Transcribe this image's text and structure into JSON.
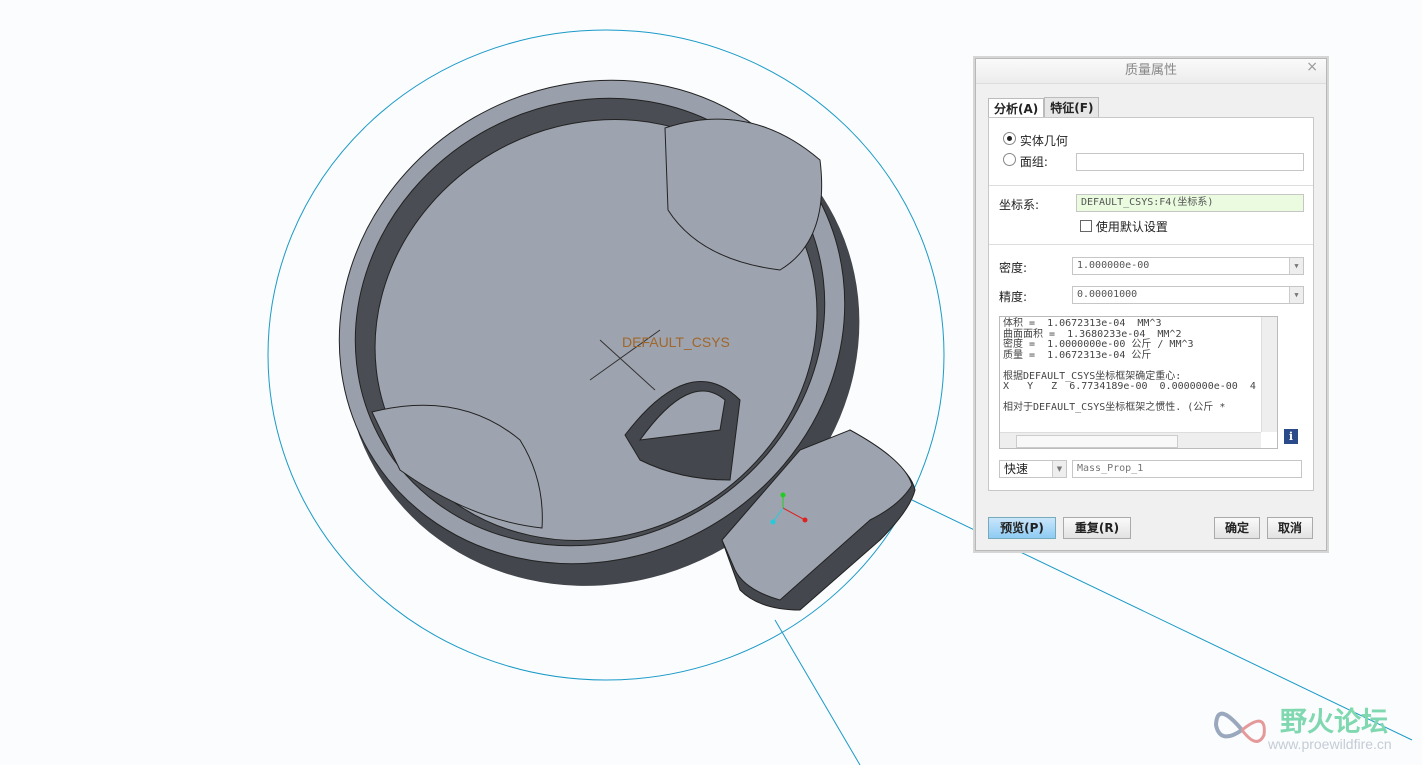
{
  "viewport": {
    "csys_label": "DEFAULT_CSYS"
  },
  "dialog": {
    "title": "质量属性",
    "close_icon": "×",
    "tabs": [
      {
        "label": "分析(A)",
        "active": true
      },
      {
        "label": "特征(F)",
        "active": false
      }
    ],
    "geometry": {
      "solid_label": "实体几何",
      "solid_selected": true,
      "quilt_label": "面组:",
      "quilt_value": ""
    },
    "csys": {
      "label": "坐标系:",
      "value": "DEFAULT_CSYS:F4(坐标系)",
      "use_default_label": "使用默认设置",
      "use_default_checked": false
    },
    "density": {
      "label": "密度:",
      "value": "1.000000e-00"
    },
    "accuracy": {
      "label": "精度:",
      "value": "0.00001000"
    },
    "results": "体积 =  1.0672313e-04  MM^3\n曲面面积 =  1.3680233e-04  MM^2\n密度 =  1.0000000e-00 公斤 / MM^3\n质量 =  1.0672313e-04 公斤\n\n根据DEFAULT_CSYS坐标框架确定重心:\nX   Y   Z  6.7734189e-00  0.0000000e-00  4\n\n相对于DEFAULT_CSYS坐标框架之惯性. (公斤 *",
    "mode": {
      "value": "快速"
    },
    "feature_name": {
      "placeholder": "Mass_Prop_1"
    },
    "buttons": {
      "preview": "预览(P)",
      "repeat": "重复(R)",
      "ok": "确定",
      "cancel": "取消"
    }
  },
  "watermark": {
    "name": "野火论坛",
    "url": "www.proewildfire.cn"
  }
}
